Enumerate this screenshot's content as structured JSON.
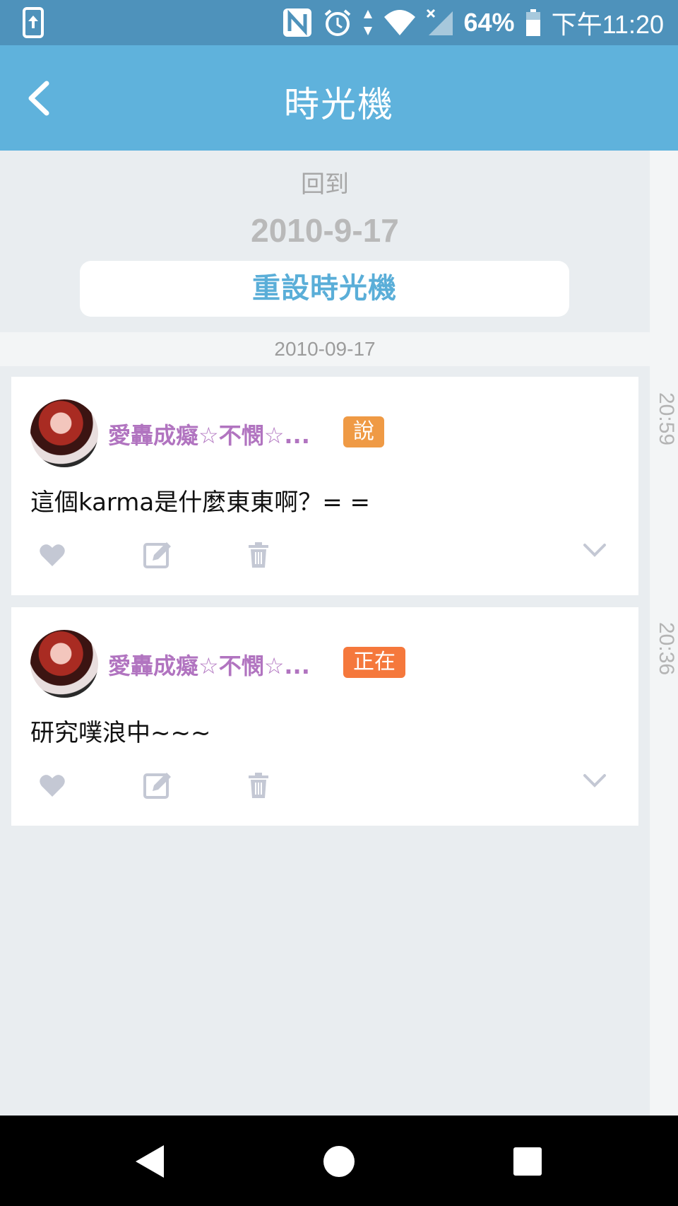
{
  "status_bar": {
    "battery_percent": "64%",
    "time": "下午11:20",
    "icons": [
      "screen-mirror-icon",
      "nfc-icon",
      "alarm-icon",
      "data-arrows-icon",
      "wifi-icon",
      "signal-icon",
      "battery-icon"
    ]
  },
  "app_bar": {
    "title": "時光機",
    "back_icon": "chevron-left-icon"
  },
  "time_machine": {
    "goto_label": "回到",
    "date": "2010-9-17",
    "reset_label": "重設時光機"
  },
  "date_separator": "2010-09-17",
  "posts": [
    {
      "username": "愛轟成癡☆不憫☆...",
      "qualifier": "說",
      "qualifier_color": "#ef9a45",
      "text": "這個karma是什麼東東啊？= =",
      "time": "20:59"
    },
    {
      "username": "愛轟成癡☆不憫☆...",
      "qualifier": "正在",
      "qualifier_color": "#f5783c",
      "text": "研究噗浪中~~~",
      "time": "20:36"
    }
  ],
  "colors": {
    "status_bar": "#4e92bb",
    "app_bar": "#5fb2dc",
    "accent": "#5aaed8",
    "username": "#b174c0",
    "background": "#e9edf0"
  }
}
